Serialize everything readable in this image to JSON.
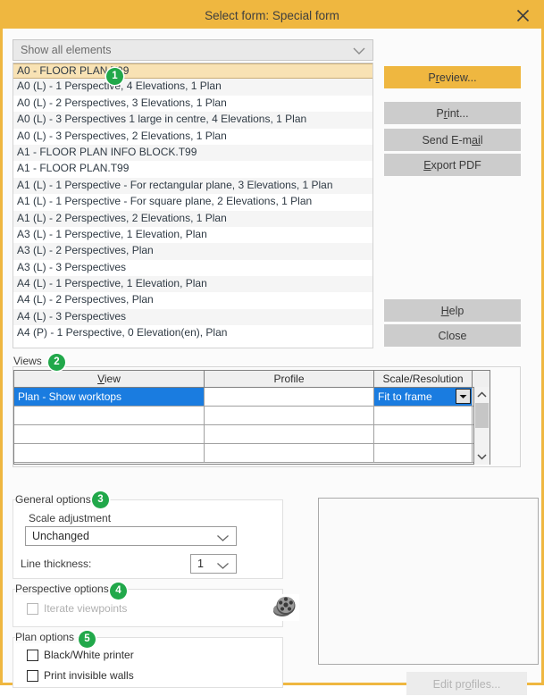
{
  "window": {
    "title": "Select form: Special form",
    "close_icon": "close-x-icon"
  },
  "filter": {
    "value": "Show all elements",
    "arrow_icon": "chevron-down-icon"
  },
  "form_list": {
    "selected_index": 0,
    "items": [
      "A0 - FLOOR PLAN.T99",
      "A0 (L) - 1 Perspective, 4 Elevations, 1 Plan",
      "A0 (L) - 2 Perspectives, 3 Elevations, 1 Plan",
      "A0 (L) - 3 Perspectives 1 large in centre, 4 Elevations, 1 Plan",
      "A0 (L) - 3 Perspectives, 2 Elevations, 1 Plan",
      "A1 - FLOOR PLAN INFO BLOCK.T99",
      "A1 - FLOOR PLAN.T99",
      "A1 (L) - 1 Perspective - For rectangular plane, 3 Elevations, 1 Plan",
      "A1 (L) - 1 Perspective - For square plane, 2 Elevations, 1 Plan",
      "A1 (L) - 2 Perspectives, 2 Elevations, 1 Plan",
      "A3 (L) - 1 Perspective, 1 Elevation, Plan",
      "A3 (L) - 2 Perspectives, Plan",
      "A3 (L) - 3 Perspectives",
      "A4 (L) - 1 Perspective, 1 Elevation, Plan",
      "A4 (L) - 2 Perspectives, Plan",
      "A4 (L) - 3 Perspectives",
      "A4 (P) - 1 Perspective, 0 Elevation(en), Plan"
    ]
  },
  "actions": {
    "preview": {
      "pre": "P",
      "accel": "r",
      "post": "eview..."
    },
    "print": {
      "pre": "P",
      "accel": "r",
      "post": "int..."
    },
    "email": {
      "pre": "Send E-m",
      "accel": "ai",
      "post": "l"
    },
    "export_pdf": {
      "pre": "",
      "accel": "E",
      "post": "xport PDF"
    },
    "help": {
      "pre": "",
      "accel": "H",
      "post": "elp"
    },
    "close": {
      "pre": "Close",
      "accel": "",
      "post": ""
    }
  },
  "views": {
    "label": "Views",
    "columns": {
      "view": {
        "pre": "",
        "accel": "V",
        "post": "iew"
      },
      "profile": "Profile",
      "scale": "Scale/Resolution"
    },
    "rows": [
      {
        "view": "Plan - Show worktops",
        "profile": "",
        "scale": "Fit to frame",
        "selected": true
      },
      {
        "view": "",
        "profile": "",
        "scale": "",
        "selected": false
      },
      {
        "view": "",
        "profile": "",
        "scale": "",
        "selected": false
      },
      {
        "view": "",
        "profile": "",
        "scale": "",
        "selected": false
      }
    ],
    "scale_arrow_icon": "caret-down-icon",
    "scroll_up_icon": "chevron-up-icon",
    "scroll_down_icon": "chevron-down-icon"
  },
  "general_options": {
    "title": "General options",
    "scale_adjustment_label": "Scale adjustment",
    "scale_adjustment_value": "Unchanged",
    "line_thickness_label": "Line thickness:",
    "line_thickness_value": "1"
  },
  "perspective_options": {
    "title": "Perspective options",
    "iterate_viewpoints_label": "Iterate viewpoints",
    "iterate_viewpoints_checked": false,
    "iterate_viewpoints_enabled": false,
    "icon": "film-reel-icon"
  },
  "plan_options": {
    "title": "Plan options",
    "items": [
      {
        "label": "Black/White printer",
        "checked": false
      },
      {
        "label": "Print invisible walls",
        "checked": false
      }
    ]
  },
  "preview": {
    "edit_profiles": {
      "pre": "Edit pr",
      "accel": "o",
      "post": "files..."
    }
  },
  "badges": [
    "1",
    "2",
    "3",
    "4",
    "5"
  ],
  "colors": {
    "accent": "#efb740",
    "selection_blue": "#1a7ce0",
    "list_selection": "#f8e2b4",
    "badge_green": "#21a84a"
  }
}
